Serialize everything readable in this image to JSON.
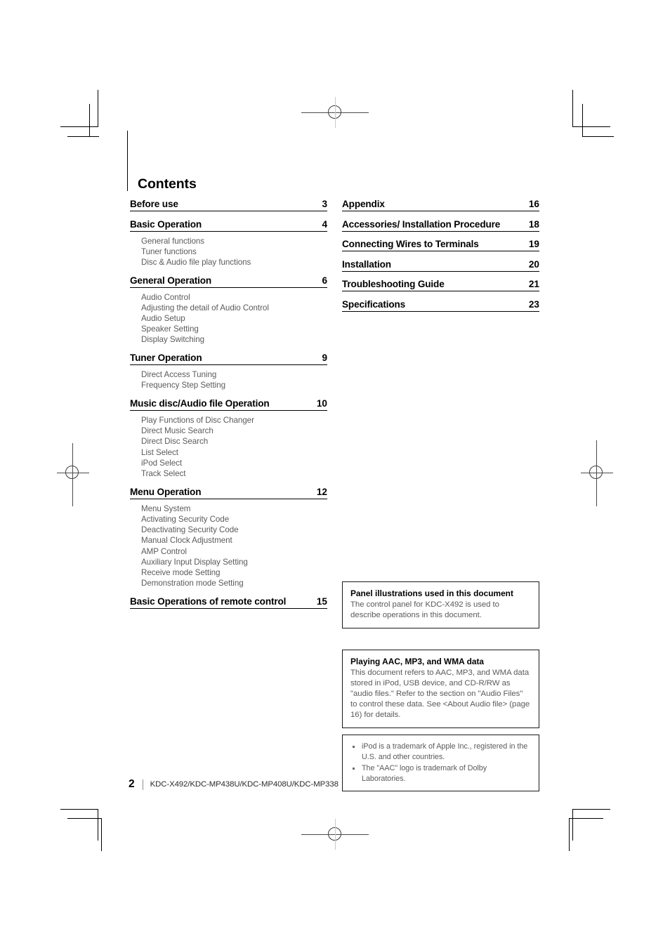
{
  "document": {
    "title": "Contents",
    "footer": {
      "page_number": "2",
      "models": "KDC-X492/KDC-MP438U/KDC-MP408U/KDC-MP338"
    }
  },
  "contents": {
    "left_column": [
      {
        "title": "Before use",
        "page": "3",
        "subs": []
      },
      {
        "title": "Basic Operation",
        "page": "4",
        "subs": [
          "General functions",
          "Tuner functions",
          "Disc & Audio file play functions"
        ]
      },
      {
        "title": "General Operation",
        "page": "6",
        "subs": [
          "Audio Control",
          "Adjusting the detail of Audio Control",
          "Audio Setup",
          "Speaker Setting",
          "Display Switching"
        ]
      },
      {
        "title": "Tuner Operation",
        "page": "9",
        "subs": [
          "Direct Access Tuning",
          "Frequency Step Setting"
        ]
      },
      {
        "title": "Music disc/Audio file Operation",
        "page": "10",
        "subs": [
          "Play Functions of Disc Changer",
          "Direct Music Search",
          "Direct Disc Search",
          "List Select",
          "iPod Select",
          "Track Select"
        ]
      },
      {
        "title": "Menu Operation",
        "page": "12",
        "subs": [
          "Menu System",
          "Activating Security Code",
          "Deactivating Security Code",
          "Manual Clock Adjustment",
          "AMP Control",
          "Auxiliary Input Display Setting",
          "Receive mode Setting",
          "Demonstration mode Setting"
        ]
      },
      {
        "title": "Basic Operations of remote control",
        "page": "15",
        "subs": []
      }
    ],
    "right_column": [
      {
        "title": "Appendix",
        "page": "16",
        "subs": []
      },
      {
        "title": "Accessories/ Installation Procedure",
        "page": "18",
        "subs": []
      },
      {
        "title": "Connecting Wires to Terminals",
        "page": "19",
        "subs": []
      },
      {
        "title": "Installation",
        "page": "20",
        "subs": []
      },
      {
        "title": "Troubleshooting Guide",
        "page": "21",
        "subs": []
      },
      {
        "title": "Specifications",
        "page": "23",
        "subs": []
      }
    ]
  },
  "notes": [
    {
      "title": "Panel illustrations used in this document",
      "body": "The control panel for KDC-X492 is used to describe operations in this document."
    },
    {
      "title": "Playing AAC, MP3, and WMA data",
      "body": "This document refers to AAC, MP3, and WMA data stored in iPod, USB device, and CD-R/RW as \"audio files.\" Refer to the section on \"Audio Files\" to control these data. See <About Audio file> (page 16) for details."
    }
  ],
  "trademarks": [
    "iPod is a trademark of Apple Inc., registered in the U.S. and other countries.",
    "The \"AAC\" logo is trademark of Dolby Laboratories."
  ]
}
